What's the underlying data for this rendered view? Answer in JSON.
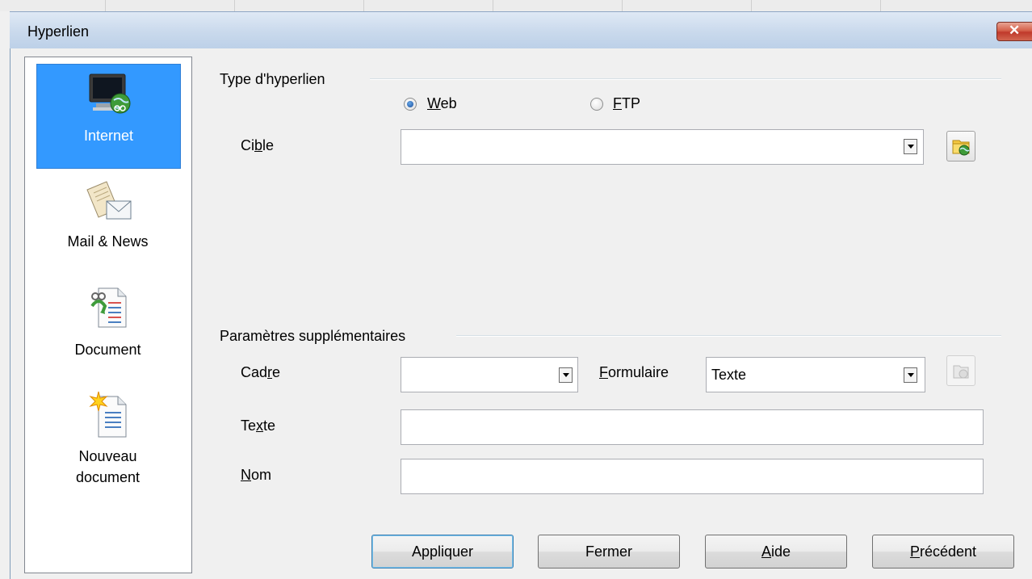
{
  "window": {
    "title": "Hyperlien"
  },
  "nav": [
    {
      "label": "Internet",
      "selected": true,
      "icon": "monitor-globe-icon"
    },
    {
      "label": "Mail & News",
      "selected": false,
      "icon": "mail-letter-icon"
    },
    {
      "label": "Document",
      "selected": false,
      "icon": "document-link-icon"
    },
    {
      "label_line1": "Nouveau",
      "label_line2": "document",
      "selected": false,
      "icon": "new-document-icon"
    }
  ],
  "hyperlink_type": {
    "title": "Type d'hyperlien",
    "options": [
      {
        "label_hotkey": "W",
        "label_rest": "eb",
        "checked": true
      },
      {
        "label_hotkey": "F",
        "label_rest": "TP",
        "checked": false
      }
    ]
  },
  "target": {
    "label_pre": "Ci",
    "label_hotkey": "b",
    "label_post": "le",
    "value": ""
  },
  "extra_params": {
    "title": "Paramètres supplémentaires",
    "frame": {
      "label_pre": "Cad",
      "label_hotkey": "r",
      "label_post": "e",
      "value": ""
    },
    "form": {
      "label_pre": "",
      "label_hotkey": "F",
      "label_post": "ormulaire",
      "value": "Texte"
    },
    "text": {
      "label_pre": "Te",
      "label_hotkey": "x",
      "label_post": "te",
      "value": ""
    },
    "name": {
      "label_pre": "",
      "label_hotkey": "N",
      "label_post": "om",
      "value": ""
    }
  },
  "buttons": {
    "apply": "Appliquer",
    "close": "Fermer",
    "help_hotkey": "A",
    "help_rest": "ide",
    "back_hotkey": "P",
    "back_rest": "récédent"
  },
  "colors": {
    "selection": "#3399ff",
    "titlebar": "#c9d9ec",
    "close": "#c0392b"
  }
}
